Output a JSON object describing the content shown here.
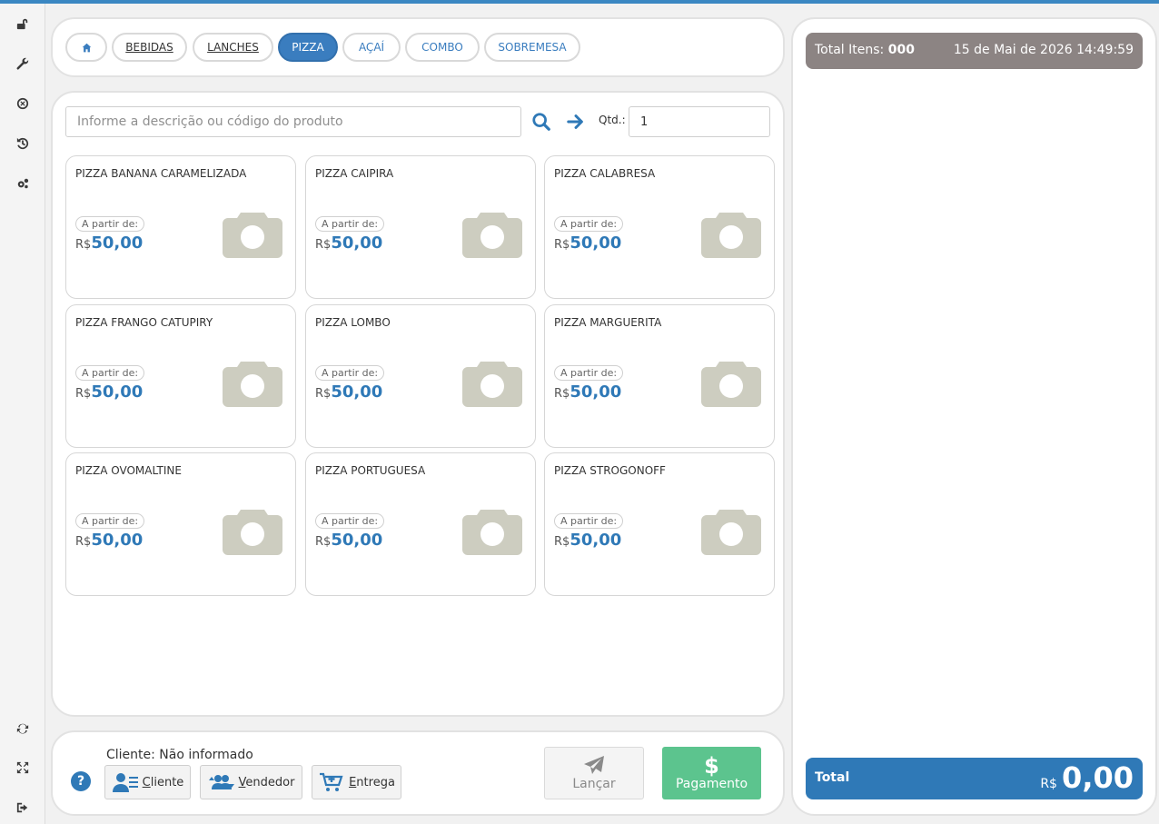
{
  "sidebar": {
    "top_icons": [
      "unlock-icon",
      "wrench-icon",
      "close-circle-icon",
      "history-icon",
      "cogs-icon"
    ],
    "bottom_icons": [
      "refresh-icon",
      "fullscreen-icon",
      "logout-icon"
    ]
  },
  "categories": [
    {
      "label": "BEBIDAS"
    },
    {
      "label": "LANCHES"
    },
    {
      "label": "PIZZA"
    },
    {
      "label": "AÇAÍ"
    },
    {
      "label": "COMBO"
    },
    {
      "label": "SOBREMESA"
    }
  ],
  "search": {
    "placeholder": "Informe a descrição ou código do produto",
    "qtd_label": "Qtd.:",
    "qtd_value": "1"
  },
  "products": [
    {
      "name": "PIZZA BANANA CARAMELIZADA",
      "from_label": "A partir de:",
      "currency": "R$",
      "price": "50,00"
    },
    {
      "name": "PIZZA CAIPIRA",
      "from_label": "A partir de:",
      "currency": "R$",
      "price": "50,00"
    },
    {
      "name": "PIZZA CALABRESA",
      "from_label": "A partir de:",
      "currency": "R$",
      "price": "50,00"
    },
    {
      "name": "PIZZA FRANGO CATUPIRY",
      "from_label": "A partir de:",
      "currency": "R$",
      "price": "50,00"
    },
    {
      "name": "PIZZA LOMBO",
      "from_label": "A partir de:",
      "currency": "R$",
      "price": "50,00"
    },
    {
      "name": "PIZZA MARGUERITA",
      "from_label": "A partir de:",
      "currency": "R$",
      "price": "50,00"
    },
    {
      "name": "PIZZA OVOMALTINE",
      "from_label": "A partir de:",
      "currency": "R$",
      "price": "50,00"
    },
    {
      "name": "PIZZA PORTUGUESA",
      "from_label": "A partir de:",
      "currency": "R$",
      "price": "50,00"
    },
    {
      "name": "PIZZA STROGONOFF",
      "from_label": "A partir de:",
      "currency": "R$",
      "price": "50,00"
    }
  ],
  "bottom": {
    "cliente_text": "Cliente: Não informado",
    "help": "?",
    "cliente_btn": "Cliente",
    "vendedor_btn": "Vendedor",
    "entrega_btn": "Entrega",
    "lancar_btn": "Lançar",
    "pagamento_symbol": "$",
    "pagamento_btn": "Pagamento"
  },
  "summary": {
    "total_itens_label": "Total Itens:",
    "total_itens_value": "000",
    "datetime": "15 de Mai de 2026 14:49:59"
  },
  "total": {
    "label": "Total",
    "currency": "R$",
    "value": "0,00"
  },
  "colors": {
    "accent": "#2f79b7",
    "pay": "#5cc48e",
    "summary_bg": "#8c8483",
    "camera": "#cdcdc0"
  }
}
